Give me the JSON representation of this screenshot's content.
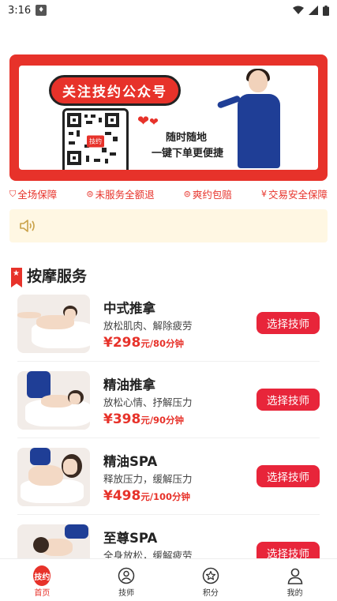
{
  "status_bar": {
    "time": "3:16",
    "drop_icon": "drop-icon"
  },
  "banner": {
    "title": "关注技约公众号",
    "qr_center_text": "技约",
    "slogan_line1": "随时随地",
    "slogan_line2": "一键下单更便捷"
  },
  "guarantees": [
    {
      "icon": "shield-icon",
      "glyph": "⛉",
      "label": "全场保障"
    },
    {
      "icon": "refund-icon",
      "glyph": "⊜",
      "label": "未服务全额退"
    },
    {
      "icon": "refund-icon",
      "glyph": "⊜",
      "label": "爽约包赔"
    },
    {
      "icon": "yen-icon",
      "glyph": "¥",
      "label": "交易安全保障"
    }
  ],
  "section": {
    "title": "按摩服务"
  },
  "services": [
    {
      "name": "中式推拿",
      "desc": "放松肌肉、解除疲劳",
      "price": "¥298",
      "unit": "元/80分钟",
      "button": "选择技师"
    },
    {
      "name": "精油推拿",
      "desc": "放松心情、抒解压力",
      "price": "¥398",
      "unit": "元/90分钟",
      "button": "选择技师"
    },
    {
      "name": "精油SPA",
      "desc": "释放压力，缓解压力",
      "price": "¥498",
      "unit": "元/100分钟",
      "button": "选择技师"
    },
    {
      "name": "至尊SPA",
      "desc": "全身放松，缓解疲劳",
      "price": "",
      "unit": "",
      "button": "选择技师"
    }
  ],
  "tabbar": {
    "home_badge": "技约",
    "items": [
      {
        "label": "首页",
        "icon": "home-icon",
        "active": true
      },
      {
        "label": "技师",
        "icon": "technician-icon",
        "active": false
      },
      {
        "label": "积分",
        "icon": "points-star-icon",
        "active": false
      },
      {
        "label": "我的",
        "icon": "profile-icon",
        "active": false
      }
    ]
  },
  "colors": {
    "brand_red": "#e7322a",
    "button_red": "#e8253a",
    "notice_bg": "#fff7e3"
  }
}
